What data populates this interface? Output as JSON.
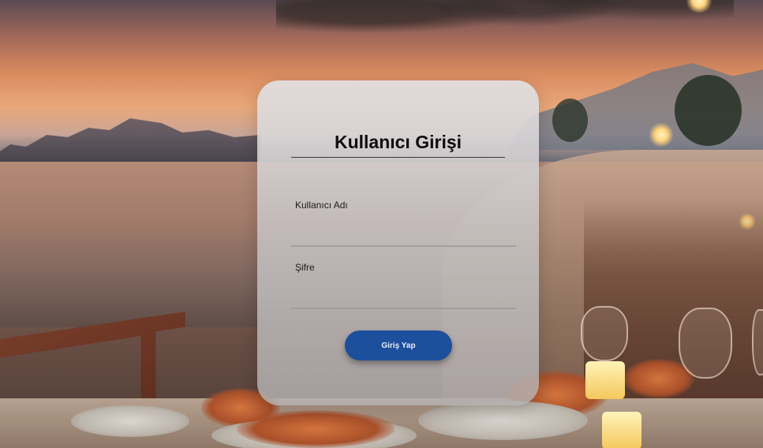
{
  "login": {
    "title": "Kullanıcı Girişi",
    "username_label": "Kullanıcı Adı",
    "username_value": "",
    "password_label": "Şifre",
    "password_value": "",
    "submit_label": "Giriş Yap"
  },
  "colors": {
    "button": "#1c4f9c",
    "card": "#d8d6d7"
  }
}
